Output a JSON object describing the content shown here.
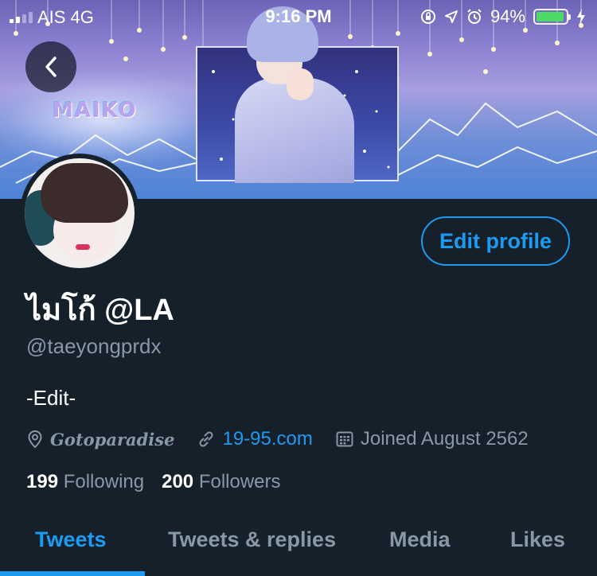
{
  "status_bar": {
    "carrier": "AIS",
    "network": "4G",
    "time": "9:16 PM",
    "battery_percent": "94%",
    "battery_level": 0.94,
    "battery_color": "#4cd964",
    "icons": [
      "orientation-lock-icon",
      "location-arrow-icon",
      "alarm-icon",
      "battery-icon",
      "charging-bolt-icon"
    ]
  },
  "header": {
    "back_icon": "chevron-left-icon",
    "banner_logo_text": "MAIKO"
  },
  "profile": {
    "display_name": "ไมโก้ @LA",
    "handle": "@taeyongprdx",
    "bio": "-Edit-",
    "location": "Gotoparadise",
    "website": "19-95.com",
    "joined": "Joined August 2562",
    "edit_profile_label": "Edit profile",
    "following_count": "199",
    "following_label": "Following",
    "followers_count": "200",
    "followers_label": "Followers"
  },
  "tabs": [
    {
      "label": "Tweets",
      "active": true
    },
    {
      "label": "Tweets & replies",
      "active": false
    },
    {
      "label": "Media",
      "active": false
    },
    {
      "label": "Likes",
      "active": false
    }
  ],
  "colors": {
    "background": "#15202b",
    "accent": "#1d9bf0",
    "secondary_text": "#8899a6",
    "primary_text": "#ffffff"
  }
}
